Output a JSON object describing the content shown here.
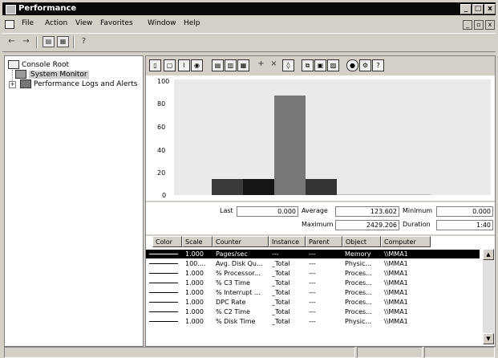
{
  "window": {
    "title": "Performance",
    "minimize": "_",
    "maximize": "□",
    "close": "x"
  },
  "menu": [
    {
      "label": "File"
    },
    {
      "label": "Action"
    },
    {
      "label": "View"
    },
    {
      "label": "Favorites"
    },
    {
      "label": "Window"
    },
    {
      "label": "Help"
    }
  ],
  "mdi": {
    "minimize": "_",
    "restore": "ฮ",
    "close": "x"
  },
  "toolbar1": {
    "back_icon": "back-arrow",
    "forward_icon": "forward-arrow"
  },
  "tree": {
    "root": "Console Root",
    "items": [
      {
        "label": "System Monitor"
      },
      {
        "label": "Performance Logs and Alerts",
        "expander": "+"
      }
    ]
  },
  "graph": {
    "yticks": [
      "100",
      "80",
      "60",
      "40",
      "20",
      "0"
    ],
    "bars": [
      {
        "value": 14,
        "color": "#3a3a3a"
      },
      {
        "value": 14,
        "color": "#161616"
      },
      {
        "value": 86,
        "color": "#777777"
      },
      {
        "value": 14,
        "color": "#333333"
      },
      {
        "value": 0,
        "color": "#bbbbbb"
      },
      {
        "value": 0,
        "color": "#bbbbbb"
      },
      {
        "value": 0,
        "color": "#bbbbbb"
      }
    ],
    "ymax": 100
  },
  "stats": {
    "last_label": "Last",
    "last": "0.000",
    "average_label": "Average",
    "average": "123.602",
    "minimum_label": "Minimum",
    "minimum": "0.000",
    "maximum_label": "Maximum",
    "maximum": "2429.206",
    "duration_label": "Duration",
    "duration": "1:40"
  },
  "columns": [
    "Color",
    "Scale",
    "Counter",
    "Instance",
    "Parent",
    "Object",
    "Computer"
  ],
  "counters": [
    {
      "scale": "1.000",
      "counter": "Pages/sec",
      "instance": "---",
      "parent": "---",
      "object": "Memory",
      "computer": "\\\\MMA1",
      "selected": true
    },
    {
      "scale": "100....",
      "counter": "Avg. Disk Qu...",
      "instance": "_Total",
      "parent": "---",
      "object": "Physic...",
      "computer": "\\\\MMA1"
    },
    {
      "scale": "1.000",
      "counter": "% Processor...",
      "instance": "_Total",
      "parent": "---",
      "object": "Proces...",
      "computer": "\\\\MMA1"
    },
    {
      "scale": "1.000",
      "counter": "% C3 Time",
      "instance": "_Total",
      "parent": "---",
      "object": "Proces...",
      "computer": "\\\\MMA1"
    },
    {
      "scale": "1.000",
      "counter": "% Interrupt ...",
      "instance": "_Total",
      "parent": "---",
      "object": "Proces...",
      "computer": "\\\\MMA1"
    },
    {
      "scale": "1.000",
      "counter": "DPC Rate",
      "instance": "_Total",
      "parent": "---",
      "object": "Proces...",
      "computer": "\\\\MMA1"
    },
    {
      "scale": "1.000",
      "counter": "% C2 Time",
      "instance": "_Total",
      "parent": "---",
      "object": "Proces...",
      "computer": "\\\\MMA1"
    },
    {
      "scale": "1.000",
      "counter": "% Disk Time",
      "instance": "_Total",
      "parent": "---",
      "object": "Physic...",
      "computer": "\\\\MMA1"
    }
  ]
}
